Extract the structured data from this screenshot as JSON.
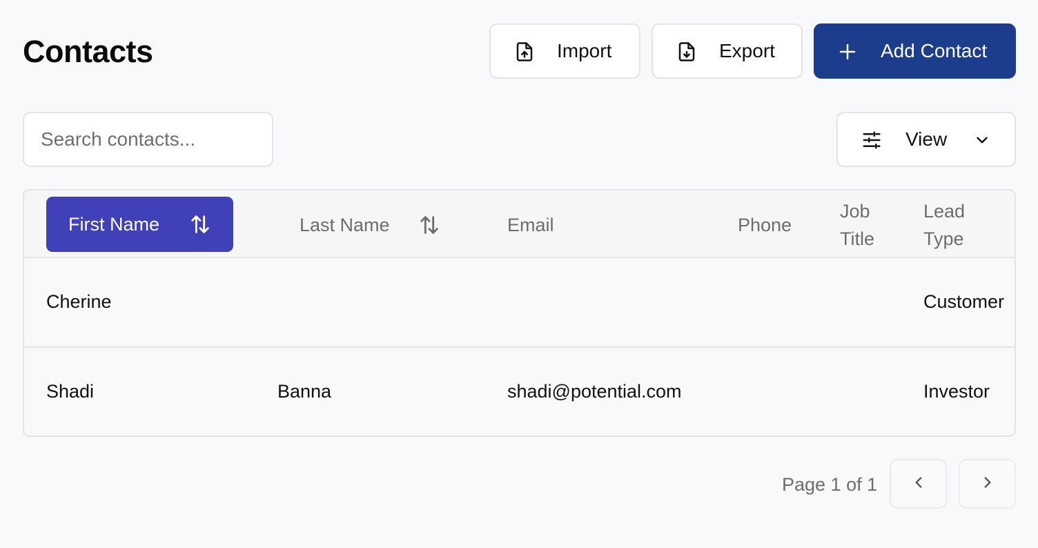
{
  "page": {
    "title": "Contacts"
  },
  "toolbar": {
    "import_label": "Import",
    "export_label": "Export",
    "add_label": "Add Contact"
  },
  "search": {
    "placeholder": "Search contacts...",
    "value": ""
  },
  "view": {
    "label": "View"
  },
  "table": {
    "columns": {
      "first_name": "First Name",
      "last_name": "Last Name",
      "email": "Email",
      "phone": "Phone",
      "job_title": "Job Title",
      "lead_type": "Lead Type"
    },
    "rows": [
      {
        "first_name": "Cherine",
        "last_name": "",
        "email": "",
        "phone": "",
        "job_title": "",
        "lead_type": "Customer"
      },
      {
        "first_name": "Shadi",
        "last_name": "Banna",
        "email": "shadi@potential.com",
        "phone": "",
        "job_title": "",
        "lead_type": "Investor"
      }
    ]
  },
  "pagination": {
    "label": "Page 1 of 1"
  },
  "colors": {
    "accent": "#1b3d8c",
    "active_column": "#4040b8",
    "background": "#f8f9fb",
    "border": "#e3e4e8"
  },
  "icons": {
    "import": "file-upload-icon",
    "export": "file-download-icon",
    "add": "plus-icon",
    "view": "sliders-icon",
    "dropdown": "chevron-down-icon",
    "sort": "sort-arrows-icon",
    "prev": "chevron-left-icon",
    "next": "chevron-right-icon"
  }
}
